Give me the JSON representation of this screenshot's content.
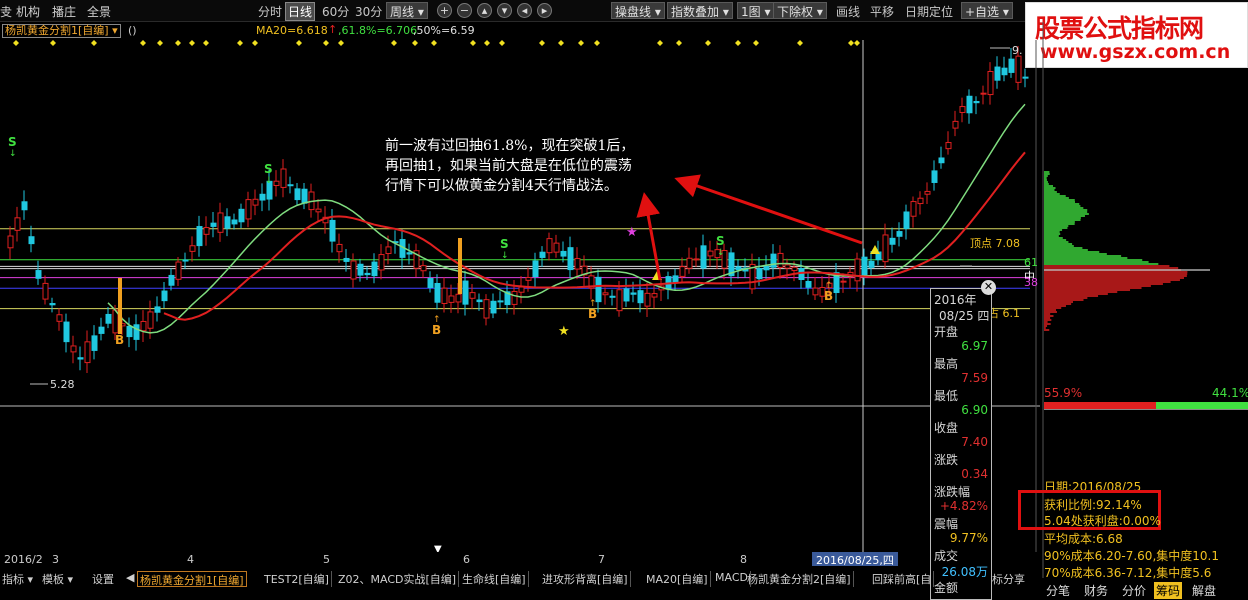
{
  "menu": {
    "items": [
      "叏",
      "机构",
      "播庄",
      "全景"
    ],
    "periods": [
      "分时",
      "日线",
      "60分",
      "30分"
    ],
    "period_dropdown": "周线",
    "right_dropdowns": [
      "操盘线",
      "指数叠加",
      "1图",
      "下除权"
    ],
    "right_buttons": [
      "画线",
      "平移",
      "日期定位"
    ],
    "add_self": "+自选",
    "logo_line1": "股票公式指标网",
    "logo_line2": "www.gszx.com.cn"
  },
  "formula": {
    "name": "杨凯黄金分割1[自编]",
    "params": "()",
    "ma": "MA20=6.618",
    "fib618": ",61.8%=6.706",
    "fib50": ",50%=6.59"
  },
  "annotation": {
    "line1": "前一波有过回抽61.8%，现在突破1后，",
    "line2": "再回抽1，如果当前大盘是在低位的震荡",
    "line3": "行情下可以做黄金分割4天行情战法。"
  },
  "chart_data": {
    "type": "candlestick",
    "y_labels": {
      "low": "5.28",
      "top": "顶点 7.08",
      "bottom_fib": "占 6.1",
      "high": "9."
    },
    "signals_S": [
      "S",
      "S",
      "S",
      "S"
    ],
    "signals_B": [
      "B",
      "B",
      "B",
      "B"
    ],
    "ma_line_colors": {
      "ma_green": "#7fdc7f",
      "ma_red": "#e02020"
    },
    "fib_lines": [
      "61",
      "中",
      "38"
    ]
  },
  "popup": {
    "year": "2016年",
    "date": "08/25 四",
    "open_label": "开盘",
    "open": "6.97",
    "high_label": "最高",
    "high": "7.59",
    "low_label": "最低",
    "low": "6.90",
    "close_label": "收盘",
    "close": "7.40",
    "change_label": "涨跌",
    "change": "0.34",
    "pct_label": "涨跌幅",
    "pct": "+4.82%",
    "amp_label": "震幅",
    "amp": "9.77%",
    "vol_label": "成交",
    "vol": "26.08万",
    "amt_label": "金额"
  },
  "axis": {
    "dates": [
      "2016/2",
      "3",
      "4",
      "5",
      "6",
      "7",
      "8"
    ],
    "cursor_date": "2016/08/25,四"
  },
  "tabs": {
    "left_items": [
      "指标 ▾",
      "模板 ▾",
      "设置"
    ],
    "items": [
      "杨凯黄金分割1[自编]",
      "TEST2[自编]",
      "Z02、MACD实战[自编]",
      "生命线[自编]",
      "进攻形背离[自编]",
      "MA20[自编]",
      "MACD",
      "杨凯黄金分割2[自编]",
      "回踩前高[自"
    ],
    "tail": "标分享"
  },
  "side": {
    "pct_left": "55.9%",
    "pct_right": "44.1%",
    "date": "日期:2016/08/25",
    "profit_ratio": "获利比例:92.14%",
    "profit_disk": "5.04处获利盘:0.00%",
    "avg_cost": "平均成本:6.68",
    "cost90": "90%成本6.20-7.60,集中度10.1",
    "cost70": "70%成本6.36-7.12,集中度5.6",
    "tabs": [
      "分笔",
      "财务",
      "分价",
      "筹码",
      "解盘"
    ]
  }
}
